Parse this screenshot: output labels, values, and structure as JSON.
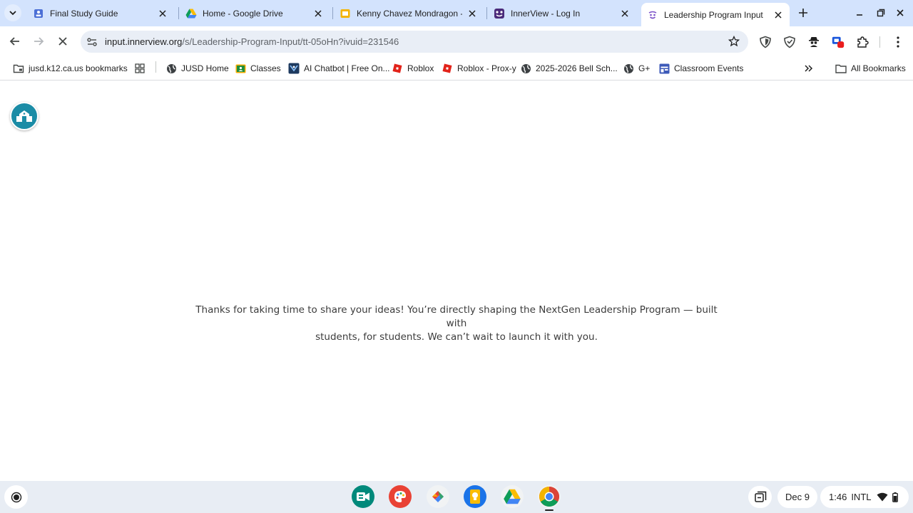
{
  "browser": {
    "tabs": [
      {
        "title": "Final Study Guide",
        "favicon": "google-forms-icon",
        "active": false
      },
      {
        "title": "Home - Google Drive",
        "favicon": "google-drive-icon",
        "active": false
      },
      {
        "title": "Kenny Chavez Mondragon - (",
        "favicon": "google-slides-icon",
        "active": false
      },
      {
        "title": "InnerView - Log In",
        "favicon": "innerview-icon",
        "active": false
      },
      {
        "title": "Leadership Program Input",
        "favicon": "innerview-icon",
        "active": true
      }
    ],
    "omnibox": {
      "host": "input.innerview.org",
      "path": "/s/Leadership-Program-Input/tt-05oHn?ivuid=231546"
    },
    "bookmarks": [
      {
        "label": "jusd.k12.ca.us bookmarks",
        "icon": "managed-bookmarks-icon"
      },
      {
        "label": "",
        "icon": "apps-grid-icon"
      },
      {
        "label": "JUSD Home",
        "icon": "globe-icon"
      },
      {
        "label": "Classes",
        "icon": "google-classroom-icon"
      },
      {
        "label": "AI Chatbot | Free On...",
        "icon": "ai-chatbot-icon"
      },
      {
        "label": "Roblox",
        "icon": "roblox-icon"
      },
      {
        "label": "Roblox - Prox-y",
        "icon": "roblox-icon"
      },
      {
        "label": "2025-2026 Bell Sch...",
        "icon": "globe-icon"
      },
      {
        "label": "G+",
        "icon": "globe-icon"
      },
      {
        "label": "Classroom Events",
        "icon": "calendar-icon"
      }
    ],
    "all_bookmarks_label": "All Bookmarks"
  },
  "page": {
    "thanks_line1": "Thanks for taking  time to share your ideas! You’re directly shaping the NextGen Leadership Program — built with",
    "thanks_line2": "students, for students. We can’t wait to launch it with you."
  },
  "shelf": {
    "date": "Dec 9",
    "time": "1:46",
    "ime": "INTL"
  },
  "colors": {
    "tabstrip": "#d3e3fd",
    "omnibox": "#e9eef6",
    "fab": "#1b8ca6",
    "shelf": "#e8edf4"
  }
}
